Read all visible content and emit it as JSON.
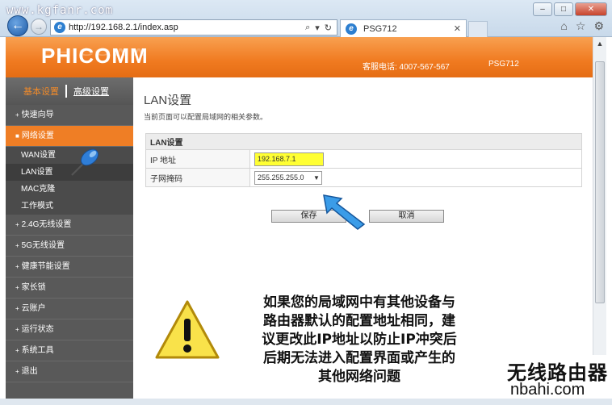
{
  "browser": {
    "watermark": "www.kgfanr.com",
    "address": "http://192.168.2.1/index.asp",
    "tab_title": "PSG712"
  },
  "header": {
    "logo": "PHICOMM",
    "hotline": "客服电话: 4007-567-567",
    "model": "PSG712"
  },
  "sidebar": {
    "basic_label": "基本设置",
    "advanced_label": "高级设置",
    "items": [
      {
        "label": "快速向导"
      },
      {
        "label": "网络设置"
      },
      {
        "label": "2.4G无线设置"
      },
      {
        "label": "5G无线设置"
      },
      {
        "label": "健康节能设置"
      },
      {
        "label": "家长锁"
      },
      {
        "label": "云账户"
      },
      {
        "label": "运行状态"
      },
      {
        "label": "系统工具"
      },
      {
        "label": "退出"
      }
    ],
    "subitems": [
      {
        "label": "WAN设置"
      },
      {
        "label": "LAN设置"
      },
      {
        "label": "MAC克隆"
      },
      {
        "label": "工作模式"
      }
    ]
  },
  "main": {
    "title": "LAN设置",
    "description": "当前页面可以配置局域网的相关参数。",
    "section_header": "LAN设置",
    "ip_label": "IP 地址",
    "ip_value": "192.168.7.1",
    "mask_label": "子网掩码",
    "mask_value": "255.255.255.0",
    "save_label": "保存",
    "cancel_label": "取消"
  },
  "annotation": {
    "line1": "如果您的局域网中有其他设备与",
    "line2": "路由器默认的配置地址相同，建",
    "line3": "议更改此IP地址以防止IP冲突后",
    "line4": "后期无法进入配置界面或产生的",
    "line5": "其他网络问题"
  },
  "footer_watermark": {
    "cn": "无线路由器",
    "en": "nbahi.com"
  },
  "colors": {
    "accent": "#ef7e25",
    "sidebar": "#595959",
    "highlight": "#ffff33"
  }
}
